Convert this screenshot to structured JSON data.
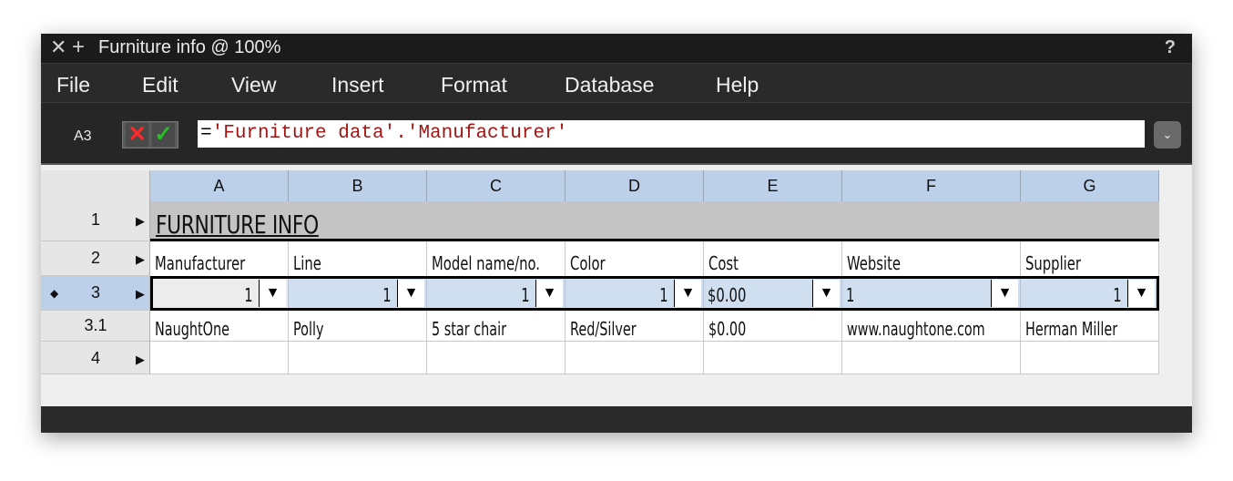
{
  "window": {
    "title": "Furniture info @ 100%",
    "close_glyph": "✕",
    "add_glyph": "+",
    "help_glyph": "?"
  },
  "menu": [
    "File",
    "Edit",
    "View",
    "Insert",
    "Format",
    "Database",
    "Help"
  ],
  "formula_bar": {
    "cell_ref": "A3",
    "cancel_glyph": "✕",
    "accept_glyph": "✓",
    "formula_prefix": "=",
    "formula_ref": "'Furniture data'.'Manufacturer'",
    "expand_glyph": "⌄",
    "ref_color": "#a31515"
  },
  "sheet": {
    "columns": [
      "A",
      "B",
      "C",
      "D",
      "E",
      "F",
      "G"
    ],
    "rows": [
      {
        "label": "1",
        "arrow": "▶",
        "marker": ""
      },
      {
        "label": "2",
        "arrow": "▶",
        "marker": ""
      },
      {
        "label": "3",
        "arrow": "▶",
        "marker": "◆"
      },
      {
        "label": "3.1",
        "arrow": "",
        "marker": ""
      },
      {
        "label": "4",
        "arrow": "▶",
        "marker": ""
      }
    ],
    "title": "FURNITURE INFO",
    "headers": [
      "Manufacturer",
      "Line",
      "Model name/no.",
      "Color",
      "Cost",
      "Website",
      "Supplier"
    ],
    "filter_values": [
      "1",
      "1",
      "1",
      "1",
      "$0.00",
      "1",
      "1"
    ],
    "dropdown_glyph": "▼",
    "data_row": [
      "NaughtOne",
      "Polly",
      "5 star chair",
      "Red/Silver",
      "$0.00",
      "www.naughtone.com",
      "Herman Miller"
    ],
    "header_color": "#bdd0ea",
    "title_band_color": "#c4c4c4"
  }
}
